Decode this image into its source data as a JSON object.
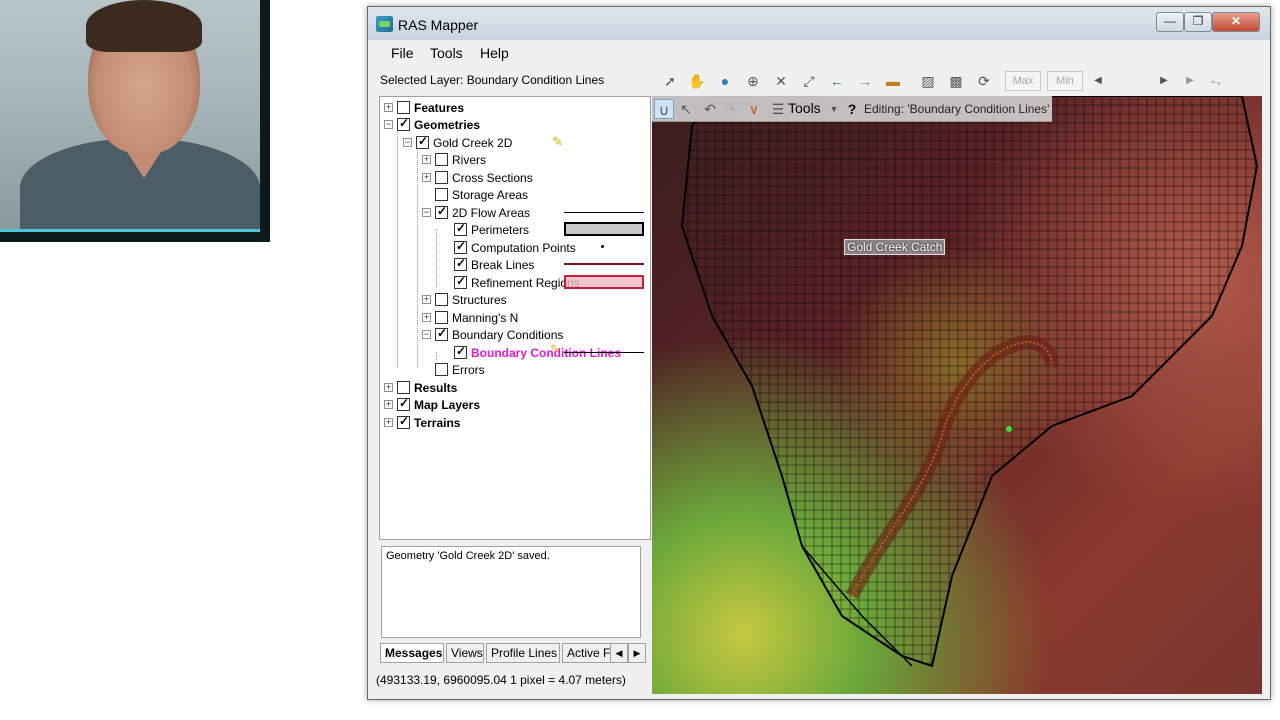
{
  "window": {
    "title": "RAS Mapper",
    "min_glyph": "—",
    "max_glyph": "❐",
    "close_glyph": "✕"
  },
  "menu": {
    "file": "File",
    "tools": "Tools",
    "help": "Help"
  },
  "selected_layer": "Selected Layer: Boundary Condition Lines",
  "toolbar": {
    "max_label": "Max",
    "min_label": "Min"
  },
  "tree": {
    "features": "Features",
    "geometries": "Geometries",
    "gold_creek": "Gold Creek 2D",
    "rivers": "Rivers",
    "cross_sections": "Cross Sections",
    "storage_areas": "Storage Areas",
    "flow_areas_2d": "2D Flow Areas",
    "perimeters": "Perimeters",
    "computation_points": "Computation Points",
    "break_lines": "Break Lines",
    "refinement_regions": "Refinement Regions",
    "structures": "Structures",
    "mannings_n": "Manning's N",
    "boundary_conditions": "Boundary Conditions",
    "boundary_condition_lines": "Boundary Condition Lines",
    "errors": "Errors",
    "results": "Results",
    "map_layers": "Map Layers",
    "terrains": "Terrains"
  },
  "messages": {
    "text": "Geometry 'Gold Creek 2D' saved."
  },
  "tabs": {
    "messages": "Messages",
    "views": "Views",
    "profile_lines": "Profile Lines",
    "active_features": "Active F"
  },
  "status": "(493133.19, 6960095.04  1 pixel = 4.07 meters)",
  "map": {
    "edit_tools_label": "Tools",
    "editing_label": "Editing: 'Boundary Condition Lines'",
    "catchment_label": "Gold Creek Catch",
    "help_glyph": "?"
  },
  "colors": {
    "accent_magenta": "#e01ad9",
    "perimeter_fill": "#c8c8c8",
    "breakline": "#7a1020",
    "refinement_fill": "#f2b6c0"
  }
}
